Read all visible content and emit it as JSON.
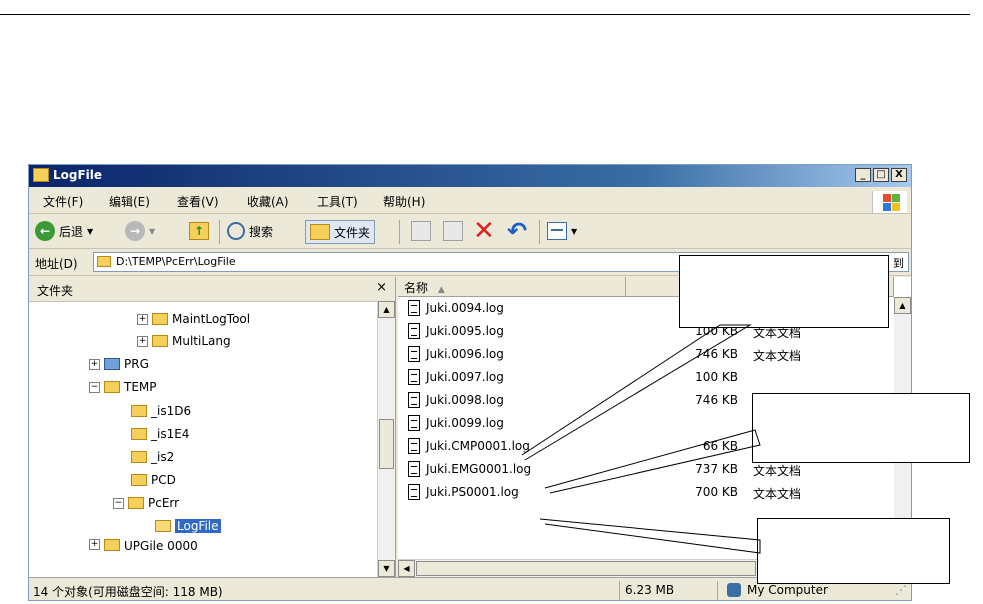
{
  "window": {
    "title": "LogFile"
  },
  "titlebar_buttons": [
    "_",
    "□",
    "X"
  ],
  "menu": [
    "文件(F)",
    "编辑(E)",
    "查看(V)",
    "收藏(A)",
    "工具(T)",
    "帮助(H)"
  ],
  "toolbar": {
    "back": "后退",
    "search": "搜索",
    "folders": "文件夹"
  },
  "address": {
    "label": "地址(D)",
    "value": "D:\\TEMP\\PcErr\\LogFile",
    "go": "到"
  },
  "folders_panel": {
    "title": "文件夹",
    "close": "×",
    "tree": [
      {
        "label": "MaintLogTool",
        "expander": "+"
      },
      {
        "label": "MultiLang",
        "expander": "+"
      },
      {
        "label": "PRG",
        "expander": "+"
      },
      {
        "label": "TEMP",
        "expander": "−"
      },
      {
        "label": "_is1D6",
        "expander": ""
      },
      {
        "label": "_is1E4",
        "expander": ""
      },
      {
        "label": "_is2",
        "expander": ""
      },
      {
        "label": "PCD",
        "expander": ""
      },
      {
        "label": "PcErr",
        "expander": "−"
      },
      {
        "label": "LogFile",
        "expander": "",
        "selected": true
      },
      {
        "label": "UPGile 0000",
        "expander": "+"
      }
    ]
  },
  "file_list": {
    "columns": [
      "名称",
      "",
      "",
      ""
    ],
    "rows": [
      {
        "name": "Juki.0094.log",
        "size": "",
        "type": "文本文档"
      },
      {
        "name": "Juki.0095.log",
        "size": "100 KB",
        "type": "文本文档"
      },
      {
        "name": "Juki.0096.log",
        "size": "746 KB",
        "type": "文本文档"
      },
      {
        "name": "Juki.0097.log",
        "size": "100 KB",
        "type": ""
      },
      {
        "name": "Juki.0098.log",
        "size": "746 KB",
        "type": ""
      },
      {
        "name": "Juki.0099.log",
        "size": "",
        "type": ""
      },
      {
        "name": "Juki.CMP0001.log",
        "size": "66 KB",
        "type": "文本文档"
      },
      {
        "name": "Juki.EMG0001.log",
        "size": "737 KB",
        "type": "文本文档"
      },
      {
        "name": "Juki.PS0001.log",
        "size": "700 KB",
        "type": "文本文档"
      }
    ]
  },
  "status": {
    "objects": "14 个对象(可用磁盘空间: 118 MB)",
    "size": "6.23 MB",
    "location": "My Computer"
  }
}
